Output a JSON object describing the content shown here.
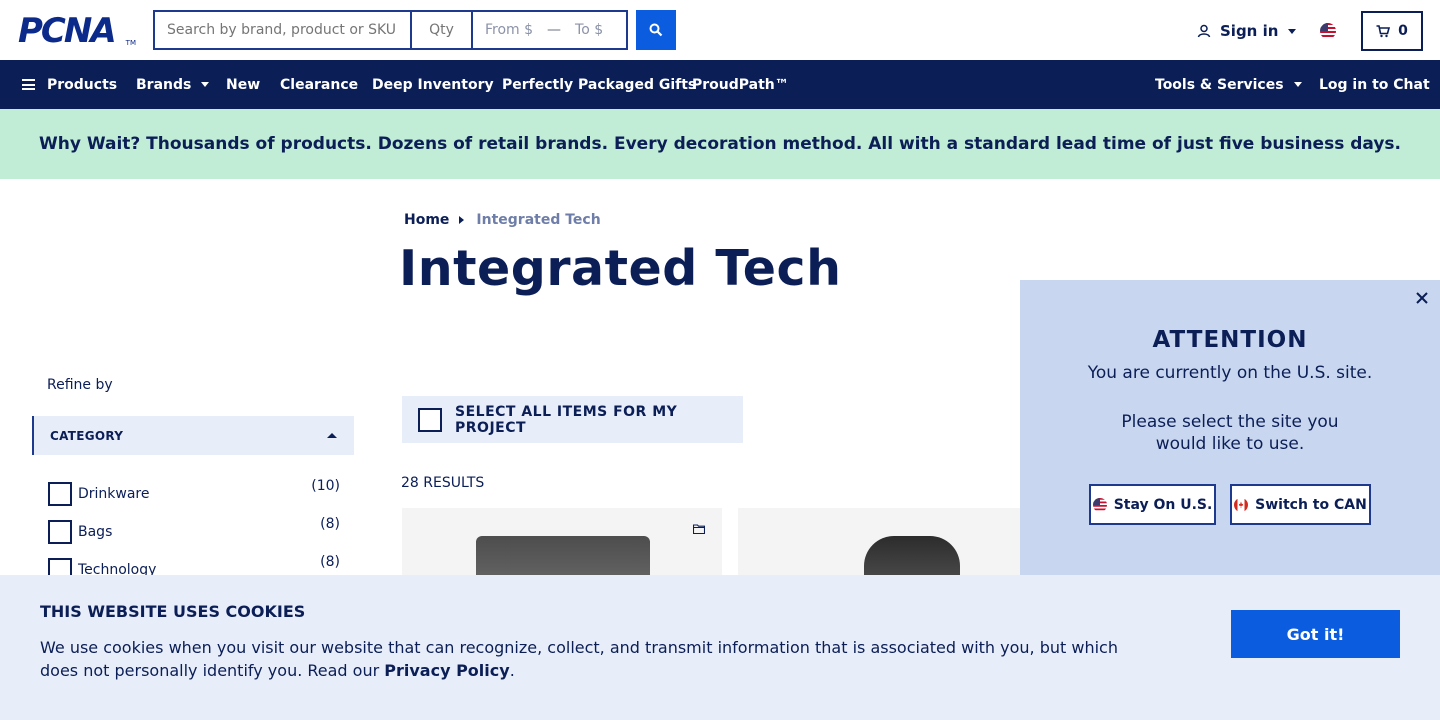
{
  "header": {
    "logo_text": "PCNA",
    "logo_tm": "TM",
    "search": {
      "placeholder": "Search by brand, product or SKU",
      "qty_placeholder": "Qty",
      "from_label": "From $",
      "to_label": "To $"
    },
    "signin_label": "Sign in",
    "cart_count": "0"
  },
  "nav": {
    "items": [
      "Products",
      "Brands",
      "New",
      "Clearance",
      "Deep Inventory",
      "Perfectly Packaged Gifts",
      "ProudPath™"
    ],
    "tools_label": "Tools & Services",
    "chat_label": "Log in to Chat"
  },
  "banner": {
    "text": "Why Wait? Thousands of products. Dozens of retail brands. Every decoration method. All with a standard lead time of just five business days."
  },
  "breadcrumb": {
    "home": "Home",
    "current": "Integrated Tech"
  },
  "page_title": "Integrated Tech",
  "sidebar": {
    "refine_label": "Refine by",
    "category_header": "CATEGORY",
    "categories": [
      {
        "label": "Drinkware",
        "count": "(10)"
      },
      {
        "label": "Bags",
        "count": "(8)"
      },
      {
        "label": "Technology",
        "count": "(8)"
      }
    ]
  },
  "main": {
    "select_all_label": "SELECT ALL ITEMS FOR MY PROJECT",
    "results_label": "28 RESULTS"
  },
  "site_popup": {
    "title": "ATTENTION",
    "line1": "You are currently on the U.S. site.",
    "line2": "Please select the site you",
    "line3": "would like to use.",
    "stay_label": "Stay On U.S.",
    "switch_label": "Switch to CAN"
  },
  "cookie": {
    "title": "THIS WEBSITE USES COOKIES",
    "text_before": "We use cookies when you visit our website that can recognize, collect, and transmit information that is associated with you, but which does not personally identify you. Read our ",
    "link": "Privacy Policy",
    "text_after": ".",
    "button_label": "Got it!"
  },
  "colors": {
    "navy": "#0b1e56",
    "accent_blue": "#0b5cde",
    "banner_green": "#c1ecd5",
    "panel_blue": "#c8d7ef",
    "light_panel": "#e8eef9"
  }
}
